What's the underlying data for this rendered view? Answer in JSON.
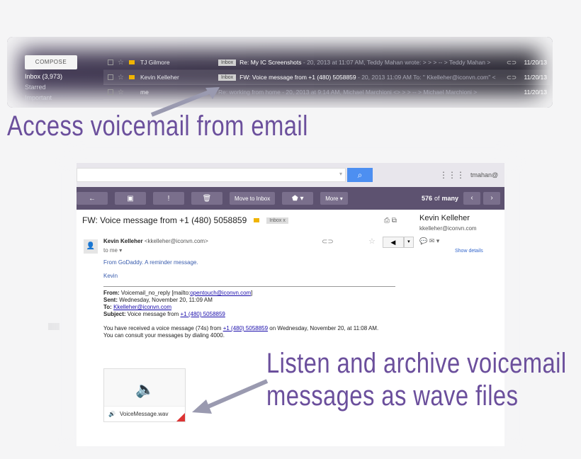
{
  "inbox": {
    "compose_label": "COMPOSE",
    "sidebar": [
      "Inbox (3,973)",
      "Starred",
      "Important"
    ],
    "rows": [
      {
        "from": "TJ Gilmore",
        "tag": "Inbox",
        "subject": "Re: My IC Screenshots",
        "snippet": " - 20, 2013 at 11:07 AM, Teddy Mahan wrote: > > > -- > Teddy Mahan >",
        "date": "11/20/13"
      },
      {
        "from": "Kevin Kelleher",
        "tag": "Inbox",
        "subject": "FW: Voice message from +1 (480) 5058859",
        "snippet": " - 20, 2013 11:09 AM To: \" Kkelleher@iconvn.com\" <",
        "date": "11/20/13"
      },
      {
        "from": "me",
        "tag": "",
        "subject": "Re: working from home",
        "snippet": " - 20, 2013 at 9:14 AM, Michael Marchioni <> > > -- > Michael Marchioni >",
        "date": "11/20/13"
      }
    ]
  },
  "captions": {
    "top": "Access voicemail from email",
    "bottom_line1": "Listen and archive voicemail",
    "bottom_line2": "messages as wave files"
  },
  "mail": {
    "account": "tmahan@",
    "toolbar": {
      "back": "←",
      "archive": "▣",
      "spam": "!",
      "delete": "🗑",
      "move_to_inbox": "Move to Inbox",
      "labels": "⬟ ▾",
      "more": "More ▾"
    },
    "pager": {
      "range": "576",
      "of": "of",
      "many": "many",
      "prev": "‹",
      "next": "›"
    },
    "subject": "FW: Voice message from +1 (480) 5058859",
    "inbox_tag": "Inbox  x",
    "sender_name": "Kevin Kelleher",
    "sender_email_bracket": "<kkelleher@iconvn.com>",
    "to_me": "to me ▾",
    "card": {
      "name": "Kevin Kelleher",
      "email": "kkelleher@iconvn.com",
      "show_details": "Show details"
    },
    "body": {
      "line1": "From GoDaddy.  A reminder message.",
      "sig": "Kevin",
      "fw_from_label": "From:",
      "fw_from": " Voicemail_no_reply [mailto:",
      "fw_from_link": "opentouch@iconvn.com",
      "fw_from_end": "]",
      "fw_sent_label": "Sent:",
      "fw_sent": " Wednesday, November 20, 11:09 AM",
      "fw_to_label": "To:",
      "fw_to_link": "Kkelleher@iconvn.com",
      "fw_subject_label": "Subject:",
      "fw_subject": " Voice message from ",
      "fw_subject_link": "+1 (480) 5058859",
      "msg_pre": "You have received a voice message (74s) from ",
      "msg_link": "+1 (480) 5058859",
      "msg_post": " on Wednesday, November 20, at 11:08 AM.",
      "msg_line2": "You can consult your messages by dialing 4000."
    },
    "attachment": {
      "name": "VoiceMessage.wav"
    }
  }
}
